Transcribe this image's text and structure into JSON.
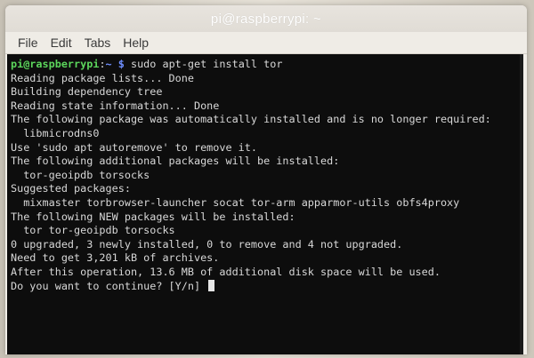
{
  "window": {
    "title": "pi@raspberrypi: ~"
  },
  "menu": {
    "items": [
      "File",
      "Edit",
      "Tabs",
      "Help"
    ]
  },
  "terminal": {
    "prompt": {
      "user_host": "pi@raspberrypi",
      "separator": ":",
      "path": "~ $",
      "command": " sudo apt-get install tor"
    },
    "lines": [
      "Reading package lists... Done",
      "Building dependency tree",
      "Reading state information... Done",
      "The following package was automatically installed and is no longer required:",
      "  libmicrodns0",
      "Use 'sudo apt autoremove' to remove it.",
      "The following additional packages will be installed:",
      "  tor-geoipdb torsocks",
      "Suggested packages:",
      "  mixmaster torbrowser-launcher socat tor-arm apparmor-utils obfs4proxy",
      "The following NEW packages will be installed:",
      "  tor tor-geoipdb torsocks",
      "0 upgraded, 3 newly installed, 0 to remove and 4 not upgraded.",
      "Need to get 3,201 kB of archives.",
      "After this operation, 13.6 MB of additional disk space will be used."
    ],
    "question": "Do you want to continue? [Y/n] "
  },
  "colors": {
    "terminal_bg": "#0d0d0d",
    "terminal_text": "#d8d8d8",
    "prompt_user": "#5cd65c",
    "prompt_path": "#6f8fff"
  }
}
